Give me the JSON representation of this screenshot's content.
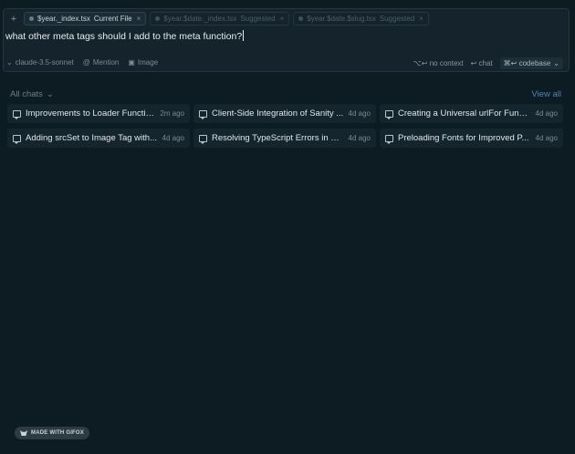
{
  "composer": {
    "add_label": "+",
    "files": [
      {
        "name": "$year._index.tsx",
        "tag": "Current File",
        "state": "current"
      },
      {
        "name": "$year.$date._index.tsx",
        "tag": "Suggested",
        "state": "suggested"
      },
      {
        "name": "$year.$date.$slug.tsx",
        "tag": "Suggested",
        "state": "suggested"
      }
    ],
    "close_glyph": "×",
    "prompt": "what other meta tags should I add to the meta function?",
    "model": "claude-3.5-sonnet",
    "mention": "Mention",
    "image": "Image",
    "no_context": "⌥↩ no context",
    "chat": "↩ chat",
    "codebase": "⌘↩ codebase"
  },
  "chats": {
    "header": "All chats",
    "view_all": "View all",
    "items": [
      {
        "title": "Improvements to Loader Functio...",
        "age": "2m ago"
      },
      {
        "title": "Client-Side Integration of Sanity ...",
        "age": "4d ago"
      },
      {
        "title": "Creating a Universal urlFor Funct...",
        "age": "4d ago"
      },
      {
        "title": "Adding srcSet to Image Tag with...",
        "age": "4d ago"
      },
      {
        "title": "Resolving TypeScript Errors in C...",
        "age": "4d ago"
      },
      {
        "title": "Preloading Fonts for Improved P...",
        "age": "4d ago"
      }
    ]
  },
  "watermark": {
    "label": "MADE WITH GIFOX"
  },
  "colors": {
    "background": "#0d1b22",
    "card": "#15252e",
    "accent": "#4d86b8"
  }
}
